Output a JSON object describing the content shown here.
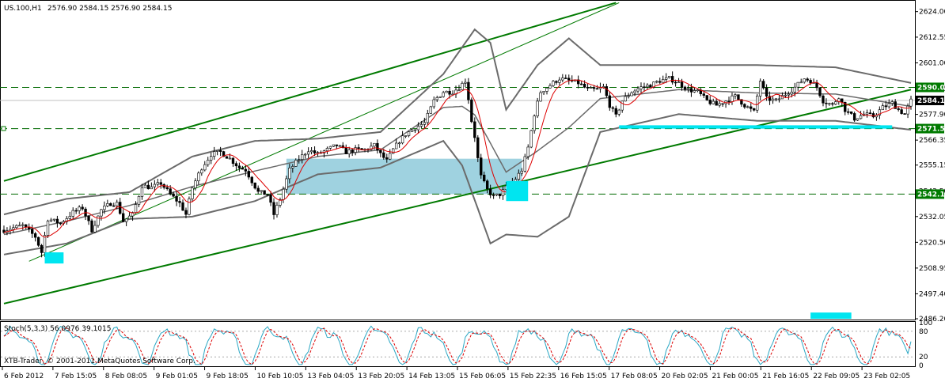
{
  "main_header": {
    "symbol_timeframe": "US.100,H1",
    "ohlc": "2576.90 2584.15 2576.90 2584.15"
  },
  "stoch_header": {
    "label": "Stoch(5,3,3) 56.0976 39.1015"
  },
  "watermark": "XTB-Trader, © 2001-2011 MetaQuotes Software Corp.",
  "price_axis": {
    "ticks": [
      "2624.00",
      "2612.55",
      "2601.00",
      "2589.55",
      "2577.90",
      "2566.35",
      "2555.15",
      "2543.50",
      "2532.05",
      "2520.50",
      "2508.95",
      "2497.40",
      "2486.20"
    ]
  },
  "stoch_axis": {
    "ticks": [
      "100",
      "80",
      "20",
      "0"
    ]
  },
  "time_axis": {
    "ticks": [
      "6 Feb 2012",
      "7 Feb 15:05",
      "8 Feb 08:05",
      "9 Feb 01:05",
      "9 Feb 18:05",
      "10 Feb 10:05",
      "13 Feb 04:05",
      "13 Feb 20:05",
      "14 Feb 13:05",
      "15 Feb 06:05",
      "15 Feb 22:35",
      "16 Feb 15:05",
      "17 Feb 08:05",
      "20 Feb 02:05",
      "21 Feb 00:05",
      "21 Feb 16:05",
      "22 Feb 09:05",
      "23 Feb 02:05"
    ]
  },
  "level_labels": {
    "resistance": "2590.01",
    "current": "2584.15",
    "mid": "2571.52",
    "support": "2542.13"
  },
  "colors": {
    "background": "#ffffff",
    "candle": "#000000",
    "bollinger": "#6b6b6b",
    "moving_average": "#dd0000",
    "channel": "#007a00",
    "horizontal_levels": "#006a00",
    "highlight_box": "#9fd2e0",
    "cyan_marker": "#00e5f0",
    "stoch_main": "#2aa7c4",
    "stoch_signal": "#dd0000"
  },
  "chart_data": {
    "type": "candlestick",
    "symbol": "US.100",
    "timeframe": "H1",
    "ylim": [
      2486.2,
      2628.5
    ],
    "ticks_y": [
      2624.0,
      2612.55,
      2601.0,
      2589.55,
      2577.9,
      2566.35,
      2555.15,
      2543.5,
      2532.05,
      2520.5,
      2508.95,
      2497.4,
      2486.2
    ],
    "x_labels": [
      "6 Feb 2012",
      "7 Feb 15:05",
      "8 Feb 08:05",
      "9 Feb 01:05",
      "9 Feb 18:05",
      "10 Feb 10:05",
      "13 Feb 04:05",
      "13 Feb 20:05",
      "14 Feb 13:05",
      "15 Feb 06:05",
      "15 Feb 22:35",
      "16 Feb 15:05",
      "17 Feb 08:05",
      "20 Feb 02:05",
      "21 Feb 00:05",
      "21 Feb 16:05",
      "22 Feb 09:05",
      "23 Feb 02:05"
    ],
    "close_path": [
      [
        0,
        2526
      ],
      [
        6,
        2528
      ],
      [
        10,
        2523
      ],
      [
        12,
        2516
      ],
      [
        14,
        2531
      ],
      [
        18,
        2529
      ],
      [
        22,
        2534
      ],
      [
        25,
        2536
      ],
      [
        28,
        2526
      ],
      [
        31,
        2535
      ],
      [
        34,
        2538
      ],
      [
        36,
        2538
      ],
      [
        38,
        2530
      ],
      [
        41,
        2533
      ],
      [
        44,
        2546
      ],
      [
        47,
        2545
      ],
      [
        50,
        2547
      ],
      [
        53,
        2542
      ],
      [
        56,
        2538
      ],
      [
        58,
        2533
      ],
      [
        60,
        2545
      ],
      [
        63,
        2554
      ],
      [
        66,
        2560
      ],
      [
        69,
        2561
      ],
      [
        72,
        2558
      ],
      [
        75,
        2554
      ],
      [
        77,
        2553
      ],
      [
        79,
        2548
      ],
      [
        81,
        2543
      ],
      [
        84,
        2542
      ],
      [
        86,
        2533
      ],
      [
        88,
        2540
      ],
      [
        91,
        2553
      ],
      [
        94,
        2558
      ],
      [
        97,
        2562
      ],
      [
        100,
        2560
      ],
      [
        103,
        2562
      ],
      [
        106,
        2564
      ],
      [
        109,
        2561
      ],
      [
        112,
        2562
      ],
      [
        115,
        2562
      ],
      [
        118,
        2564
      ],
      [
        120,
        2560
      ],
      [
        122,
        2557
      ],
      [
        124,
        2562
      ],
      [
        126,
        2566
      ],
      [
        128,
        2569
      ],
      [
        131,
        2572
      ],
      [
        134,
        2574
      ],
      [
        137,
        2584
      ],
      [
        140,
        2588
      ],
      [
        143,
        2588
      ],
      [
        145,
        2590
      ],
      [
        147,
        2593
      ],
      [
        148,
        2585
      ],
      [
        149,
        2575
      ],
      [
        150,
        2568
      ],
      [
        151,
        2558
      ],
      [
        152,
        2550
      ],
      [
        154,
        2544
      ],
      [
        156,
        2541
      ],
      [
        158,
        2542
      ],
      [
        160,
        2545
      ],
      [
        163,
        2549
      ],
      [
        165,
        2553
      ],
      [
        167,
        2563
      ],
      [
        169,
        2578
      ],
      [
        171,
        2588
      ],
      [
        174,
        2591
      ],
      [
        177,
        2594
      ],
      [
        180,
        2593
      ],
      [
        183,
        2592
      ],
      [
        186,
        2589
      ],
      [
        189,
        2589
      ],
      [
        191,
        2590
      ],
      [
        193,
        2582
      ],
      [
        195,
        2577
      ],
      [
        197,
        2584
      ],
      [
        200,
        2588
      ],
      [
        203,
        2590
      ],
      [
        206,
        2591
      ],
      [
        209,
        2593
      ],
      [
        212,
        2594
      ],
      [
        215,
        2592
      ],
      [
        218,
        2589
      ],
      [
        221,
        2588
      ],
      [
        224,
        2584
      ],
      [
        227,
        2582
      ],
      [
        230,
        2584
      ],
      [
        233,
        2586
      ],
      [
        236,
        2582
      ],
      [
        239,
        2579
      ],
      [
        241,
        2593
      ],
      [
        243,
        2585
      ],
      [
        246,
        2584
      ],
      [
        249,
        2587
      ],
      [
        252,
        2590
      ],
      [
        255,
        2594
      ],
      [
        257,
        2593
      ],
      [
        259,
        2590
      ],
      [
        261,
        2584
      ],
      [
        264,
        2582
      ],
      [
        266,
        2586
      ],
      [
        268,
        2580
      ],
      [
        271,
        2576
      ],
      [
        274,
        2578
      ],
      [
        277,
        2577
      ],
      [
        280,
        2581
      ],
      [
        283,
        2583
      ],
      [
        285,
        2580
      ],
      [
        287,
        2578
      ],
      [
        289,
        2584
      ]
    ],
    "bollinger_upper": [
      [
        0,
        2533
      ],
      [
        20,
        2540
      ],
      [
        40,
        2543
      ],
      [
        60,
        2559
      ],
      [
        80,
        2566
      ],
      [
        100,
        2567
      ],
      [
        120,
        2570
      ],
      [
        140,
        2596
      ],
      [
        146,
        2608
      ],
      [
        150,
        2616
      ],
      [
        155,
        2610
      ],
      [
        160,
        2580
      ],
      [
        170,
        2600
      ],
      [
        180,
        2612
      ],
      [
        190,
        2600
      ],
      [
        215,
        2600
      ],
      [
        240,
        2600
      ],
      [
        265,
        2599
      ],
      [
        289,
        2592
      ]
    ],
    "bollinger_lower": [
      [
        0,
        2515
      ],
      [
        20,
        2520
      ],
      [
        40,
        2531
      ],
      [
        60,
        2532
      ],
      [
        80,
        2539
      ],
      [
        100,
        2551
      ],
      [
        120,
        2554
      ],
      [
        140,
        2566
      ],
      [
        146,
        2555
      ],
      [
        155,
        2520
      ],
      [
        160,
        2524
      ],
      [
        170,
        2523
      ],
      [
        180,
        2532
      ],
      [
        190,
        2570
      ],
      [
        215,
        2578
      ],
      [
        240,
        2575
      ],
      [
        265,
        2575
      ],
      [
        289,
        2571
      ]
    ],
    "channel_upper": [
      [
        0,
        2548
      ],
      [
        195,
        2628
      ]
    ],
    "channel_lower": [
      [
        0,
        2493
      ],
      [
        289,
        2589
      ]
    ],
    "channel_mid": [
      [
        8,
        2512
      ],
      [
        196,
        2628
      ]
    ],
    "horizontal_levels": [
      {
        "price": 2590.01,
        "style": "dashed",
        "label": "2590.01"
      },
      {
        "price": 2571.52,
        "style": "dashed",
        "label": "2571.52"
      },
      {
        "price": 2542.13,
        "style": "dashed",
        "label": "2542.13"
      }
    ],
    "current_price": 2584.15,
    "zones": [
      {
        "from_bar": 90,
        "to_bar": 165,
        "price_top": 2558,
        "price_bottom": 2542.13,
        "color": "light-blue"
      }
    ],
    "markers": [
      {
        "bar_from": 13,
        "bar_to": 19,
        "price_top": 2516,
        "price_bottom": 2511
      },
      {
        "bar_from": 160,
        "bar_to": 167,
        "price_top": 2548,
        "price_bottom": 2539
      },
      {
        "bar_from": 196,
        "bar_to": 283,
        "price_top": 2573,
        "price_bottom": 2571.5
      },
      {
        "bar_from": 257,
        "bar_to": 270,
        "price_top": 2489,
        "price_bottom": 2486.2
      }
    ],
    "stochastic": {
      "k_period": 5,
      "d_period": 3,
      "slowing": 3,
      "main_value": 56.0976,
      "signal_value": 39.1015,
      "ylim": [
        0,
        100
      ],
      "levels": [
        80,
        20
      ]
    },
    "grid": false,
    "legend": "none"
  }
}
